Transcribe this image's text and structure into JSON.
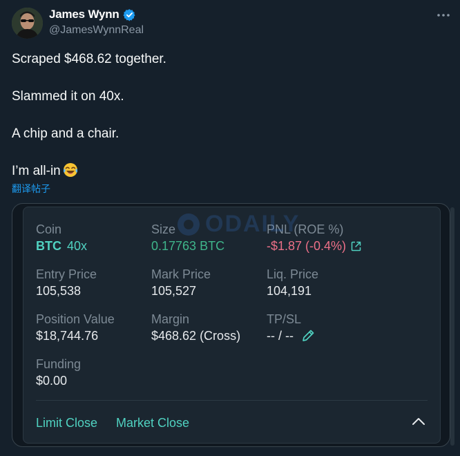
{
  "author": {
    "display_name": "James Wynn",
    "handle": "@JamesWynnReal",
    "verified_icon": "verified-badge-icon",
    "accent": "#1d9bf0"
  },
  "tweet": {
    "lines": [
      "Scraped $468.62 together.",
      "Slammed it on 40x.",
      "A chip and a chair.",
      "I’m all-in"
    ],
    "emoji": "face-with-tears-of-joy-icon",
    "translate_label": "翻译帖子"
  },
  "card": {
    "watermark": "ODAILY",
    "coin": {
      "label": "Coin",
      "symbol": "BTC",
      "leverage": "40x"
    },
    "size": {
      "label": "Size",
      "value": "0.17763 BTC"
    },
    "pnl": {
      "label": "PNL (ROE %)",
      "value": "-$1.87 (-0.4%)"
    },
    "entry_price": {
      "label": "Entry Price",
      "value": "105,538"
    },
    "mark_price": {
      "label": "Mark Price",
      "value": "105,527"
    },
    "liq_price": {
      "label": "Liq. Price",
      "value": "104,191"
    },
    "position_value": {
      "label": "Position Value",
      "value": "$18,744.76"
    },
    "margin": {
      "label": "Margin",
      "value": "$468.62 (Cross)"
    },
    "tpsl": {
      "label": "TP/SL",
      "value": "-- / --"
    },
    "funding": {
      "label": "Funding",
      "value": "$0.00"
    },
    "actions": {
      "limit_close": "Limit Close",
      "market_close": "Market Close"
    },
    "colors": {
      "accent": "#50d2c1",
      "positive": "#3fb68b",
      "negative": "#ed7088"
    }
  }
}
